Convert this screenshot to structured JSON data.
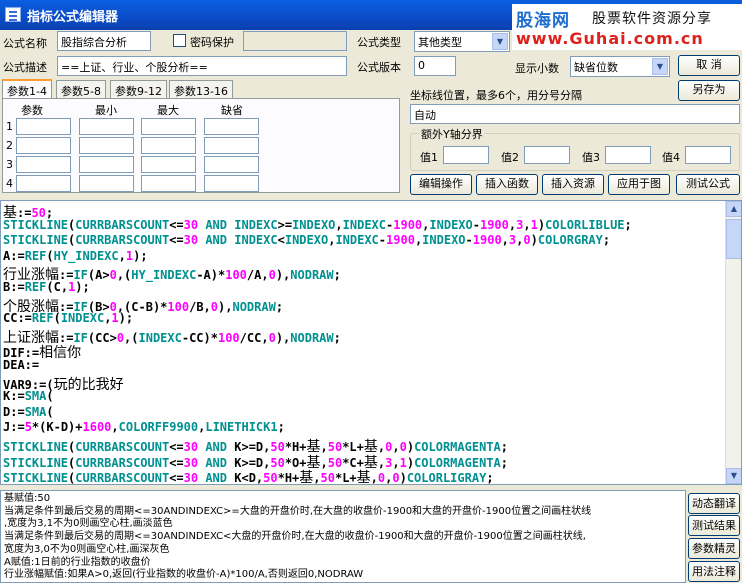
{
  "window": {
    "title": "指标公式编辑器"
  },
  "logo": {
    "site_name": "股海网",
    "tagline": "股票软件资源分享",
    "url": "www.Guhai.com.cn"
  },
  "form": {
    "name_label": "公式名称",
    "name_value": "股指综合分析",
    "password_label": "密码保护",
    "password_value": "",
    "type_label": "公式类型",
    "type_value": "其他类型",
    "desc_label": "公式描述",
    "desc_value": "==上证、行业、个股分析==",
    "version_label": "公式版本",
    "version_value": "0",
    "decimal_label": "显示小数",
    "decimal_value": "缺省位数",
    "cancel_label": "取  消",
    "saveas_label": "另存为"
  },
  "params": {
    "tabs": [
      "参数1-4",
      "参数5-8",
      "参数9-12",
      "参数13-16"
    ],
    "active_tab": 0,
    "headers": [
      "参数",
      "最小",
      "最大",
      "缺省"
    ],
    "rows": [
      "1",
      "2",
      "3",
      "4"
    ]
  },
  "axis": {
    "label": "坐标线位置，最多6个，用分号分隔",
    "value": "自动",
    "yaxis_group": "额外Y轴分界",
    "value_labels": [
      "值1",
      "值2",
      "值3",
      "值4"
    ]
  },
  "actions": [
    "编辑操作",
    "插入函数",
    "插入资源",
    "应用于图",
    "测试公式"
  ],
  "code_lines": [
    [
      [
        "n",
        "基"
      ],
      [
        "t",
        ":="
      ],
      [
        "num",
        "50"
      ],
      [
        "t",
        ";"
      ]
    ],
    [
      [
        "kw",
        "STICKLINE"
      ],
      [
        "t",
        "("
      ],
      [
        "kw",
        "CURRBARSCOUNT"
      ],
      [
        "t",
        "<="
      ],
      [
        "num",
        "30"
      ],
      [
        "t",
        " "
      ],
      [
        "kw",
        "AND"
      ],
      [
        "t",
        " "
      ],
      [
        "kw",
        "INDEXC"
      ],
      [
        "t",
        ">="
      ],
      [
        "kw",
        "INDEXO"
      ],
      [
        "t",
        ","
      ],
      [
        "kw",
        "INDEXC"
      ],
      [
        "t",
        "-"
      ],
      [
        "num",
        "1900"
      ],
      [
        "t",
        ","
      ],
      [
        "kw",
        "INDEXO"
      ],
      [
        "t",
        "-"
      ],
      [
        "num",
        "1900"
      ],
      [
        "t",
        ","
      ],
      [
        "num",
        "3"
      ],
      [
        "t",
        ","
      ],
      [
        "num",
        "1"
      ],
      [
        "t",
        ")"
      ],
      [
        "kw",
        "COLORLIBLUE"
      ],
      [
        "t",
        ";"
      ]
    ],
    [
      [
        "kw",
        "STICKLINE"
      ],
      [
        "t",
        "("
      ],
      [
        "kw",
        "CURRBARSCOUNT"
      ],
      [
        "t",
        "<="
      ],
      [
        "num",
        "30"
      ],
      [
        "t",
        " "
      ],
      [
        "kw",
        "AND"
      ],
      [
        "t",
        " "
      ],
      [
        "kw",
        "INDEXC"
      ],
      [
        "t",
        "<"
      ],
      [
        "kw",
        "INDEXO"
      ],
      [
        "t",
        ","
      ],
      [
        "kw",
        "INDEXC"
      ],
      [
        "t",
        "-"
      ],
      [
        "num",
        "1900"
      ],
      [
        "t",
        ","
      ],
      [
        "kw",
        "INDEXO"
      ],
      [
        "t",
        "-"
      ],
      [
        "num",
        "1900"
      ],
      [
        "t",
        ","
      ],
      [
        "num",
        "3"
      ],
      [
        "t",
        ","
      ],
      [
        "num",
        "0"
      ],
      [
        "t",
        ")"
      ],
      [
        "kw",
        "COLORGRAY"
      ],
      [
        "t",
        ";"
      ]
    ],
    [
      [
        "t",
        "A:="
      ],
      [
        "kw",
        "REF"
      ],
      [
        "t",
        "("
      ],
      [
        "kw",
        "HY_INDEXC"
      ],
      [
        "t",
        ","
      ],
      [
        "num",
        "1"
      ],
      [
        "t",
        ");"
      ]
    ],
    [
      [
        "n",
        "行业涨幅"
      ],
      [
        "t",
        ":="
      ],
      [
        "kw",
        "IF"
      ],
      [
        "t",
        "(A>"
      ],
      [
        "num",
        "0"
      ],
      [
        "t",
        ",("
      ],
      [
        "kw",
        "HY_INDEXC"
      ],
      [
        "t",
        "-A)*"
      ],
      [
        "num",
        "100"
      ],
      [
        "t",
        "/A,"
      ],
      [
        "num",
        "0"
      ],
      [
        "t",
        "),"
      ],
      [
        "kw",
        "NODRAW"
      ],
      [
        "t",
        ";"
      ]
    ],
    [
      [
        "t",
        "B:="
      ],
      [
        "kw",
        "REF"
      ],
      [
        "t",
        "(C,"
      ],
      [
        "num",
        "1"
      ],
      [
        "t",
        ");"
      ]
    ],
    [
      [
        "n",
        "个股涨幅"
      ],
      [
        "t",
        ":="
      ],
      [
        "kw",
        "IF"
      ],
      [
        "t",
        "(B>"
      ],
      [
        "num",
        "0"
      ],
      [
        "t",
        ",(C-B)*"
      ],
      [
        "num",
        "100"
      ],
      [
        "t",
        "/B,"
      ],
      [
        "num",
        "0"
      ],
      [
        "t",
        "),"
      ],
      [
        "kw",
        "NODRAW"
      ],
      [
        "t",
        ";"
      ]
    ],
    [
      [
        "t",
        "CC:="
      ],
      [
        "kw",
        "REF"
      ],
      [
        "t",
        "("
      ],
      [
        "kw",
        "INDEXC"
      ],
      [
        "t",
        ","
      ],
      [
        "num",
        "1"
      ],
      [
        "t",
        ");"
      ]
    ],
    [
      [
        "n",
        "上证涨幅"
      ],
      [
        "t",
        ":="
      ],
      [
        "kw",
        "IF"
      ],
      [
        "t",
        "(CC>"
      ],
      [
        "num",
        "0"
      ],
      [
        "t",
        ",("
      ],
      [
        "kw",
        "INDEXC"
      ],
      [
        "t",
        "-CC)*"
      ],
      [
        "num",
        "100"
      ],
      [
        "t",
        "/CC,"
      ],
      [
        "num",
        "0"
      ],
      [
        "t",
        "),"
      ],
      [
        "kw",
        "NODRAW"
      ],
      [
        "t",
        ";"
      ]
    ],
    [
      [
        "t",
        "DIF:="
      ],
      [
        "n",
        "相信你"
      ]
    ],
    [
      [
        "t",
        "DEA:="
      ]
    ],
    [
      [
        "t",
        "VAR9:=("
      ],
      [
        "n",
        "玩的比我好"
      ]
    ],
    [
      [
        "t",
        "K:="
      ],
      [
        "kw",
        "SMA"
      ],
      [
        "t",
        "("
      ]
    ],
    [
      [
        "t",
        "D:="
      ],
      [
        "kw",
        "SMA"
      ],
      [
        "t",
        "("
      ]
    ],
    [
      [
        "t",
        "J:="
      ],
      [
        "num",
        "5"
      ],
      [
        "t",
        "*(K-D)+"
      ],
      [
        "num",
        "1600"
      ],
      [
        "t",
        ","
      ],
      [
        "kw",
        "COLORFF9900"
      ],
      [
        "t",
        ","
      ],
      [
        "kw",
        "LINETHICK1"
      ],
      [
        "t",
        ";"
      ]
    ],
    [
      [
        "kw",
        "STICKLINE"
      ],
      [
        "t",
        "("
      ],
      [
        "kw",
        "CURRBARSCOUNT"
      ],
      [
        "t",
        "<="
      ],
      [
        "num",
        "30"
      ],
      [
        "t",
        " "
      ],
      [
        "kw",
        "AND"
      ],
      [
        "t",
        " K>=D,"
      ],
      [
        "num",
        "50"
      ],
      [
        "t",
        "*H+"
      ],
      [
        "n",
        "基"
      ],
      [
        "t",
        ","
      ],
      [
        "num",
        "50"
      ],
      [
        "t",
        "*L+"
      ],
      [
        "n",
        "基"
      ],
      [
        "t",
        ","
      ],
      [
        "num",
        "0"
      ],
      [
        "t",
        ","
      ],
      [
        "num",
        "0"
      ],
      [
        "t",
        ")"
      ],
      [
        "kw",
        "COLORMAGENTA"
      ],
      [
        "t",
        ";"
      ]
    ],
    [
      [
        "kw",
        "STICKLINE"
      ],
      [
        "t",
        "("
      ],
      [
        "kw",
        "CURRBARSCOUNT"
      ],
      [
        "t",
        "<="
      ],
      [
        "num",
        "30"
      ],
      [
        "t",
        " "
      ],
      [
        "kw",
        "AND"
      ],
      [
        "t",
        " K>=D,"
      ],
      [
        "num",
        "50"
      ],
      [
        "t",
        "*O+"
      ],
      [
        "n",
        "基"
      ],
      [
        "t",
        ","
      ],
      [
        "num",
        "50"
      ],
      [
        "t",
        "*C+"
      ],
      [
        "n",
        "基"
      ],
      [
        "t",
        ","
      ],
      [
        "num",
        "3"
      ],
      [
        "t",
        ","
      ],
      [
        "num",
        "1"
      ],
      [
        "t",
        ")"
      ],
      [
        "kw",
        "COLORMAGENTA"
      ],
      [
        "t",
        ";"
      ]
    ],
    [
      [
        "kw",
        "STICKLINE"
      ],
      [
        "t",
        "("
      ],
      [
        "kw",
        "CURRBARSCOUNT"
      ],
      [
        "t",
        "<="
      ],
      [
        "num",
        "30"
      ],
      [
        "t",
        " "
      ],
      [
        "kw",
        "AND"
      ],
      [
        "t",
        " K<D,"
      ],
      [
        "num",
        "50"
      ],
      [
        "t",
        "*H+"
      ],
      [
        "n",
        "基"
      ],
      [
        "t",
        ","
      ],
      [
        "num",
        "50"
      ],
      [
        "t",
        "*L+"
      ],
      [
        "n",
        "基"
      ],
      [
        "t",
        ","
      ],
      [
        "num",
        "0"
      ],
      [
        "t",
        ","
      ],
      [
        "num",
        "0"
      ],
      [
        "t",
        ")"
      ],
      [
        "kw",
        "COLORLIGRAY"
      ],
      [
        "t",
        ";"
      ]
    ]
  ],
  "notes": [
    "基赋值:50",
    "当满足条件到最后交易的周期<=30ANDINDEXC>=大盘的开盘价时,在大盘的收盘价-1900和大盘的开盘价-1900位置之间画柱状线",
    ",宽度为3,1不为0则画空心柱,画淡蓝色",
    "当满足条件到最后交易的周期<=30ANDINDEXC<大盘的开盘价时,在大盘的收盘价-1900和大盘的开盘价-1900位置之间画柱状线,",
    "宽度为3,0不为0则画空心柱,画深灰色",
    "A赋值:1日前的行业指数的收盘价",
    "行业涨幅赋值:如果A>0,返回(行业指数的收盘价-A)*100/A,否则返回0,NODRAW"
  ],
  "side_buttons": [
    "动态翻译",
    "测试结果",
    "参数精灵",
    "用法注释"
  ],
  "colors": {
    "keyword": "#009090",
    "number": "#ff00ff",
    "titlebar": "#0b4cc7"
  }
}
